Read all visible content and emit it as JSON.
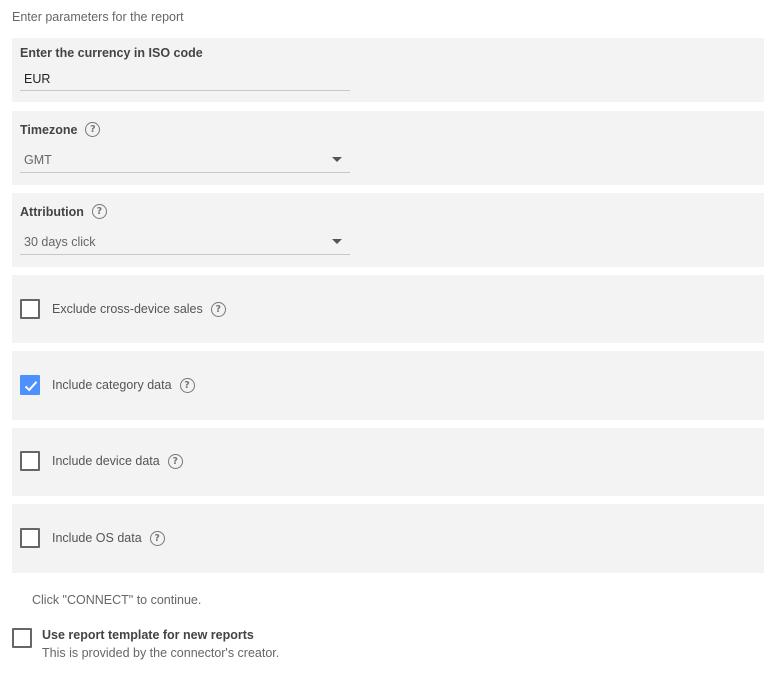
{
  "intro": "Enter parameters for the report",
  "currency": {
    "label": "Enter the currency in ISO code",
    "value": "EUR"
  },
  "timezone": {
    "label": "Timezone",
    "value": "GMT"
  },
  "attribution": {
    "label": "Attribution",
    "value": "30 days click"
  },
  "options": [
    {
      "label": "Exclude cross-device sales",
      "checked": false
    },
    {
      "label": "Include category data",
      "checked": true
    },
    {
      "label": "Include device data",
      "checked": false
    },
    {
      "label": "Include OS data",
      "checked": false
    }
  ],
  "help_icon": "question-circle-icon",
  "note": "Click \"CONNECT\" to continue.",
  "template": {
    "title": "Use report template for new reports",
    "subtitle": "This is provided by the connector's creator.",
    "checked": false
  },
  "colors": {
    "accent": "#4d90fe",
    "panel": "#f3f3f3"
  }
}
